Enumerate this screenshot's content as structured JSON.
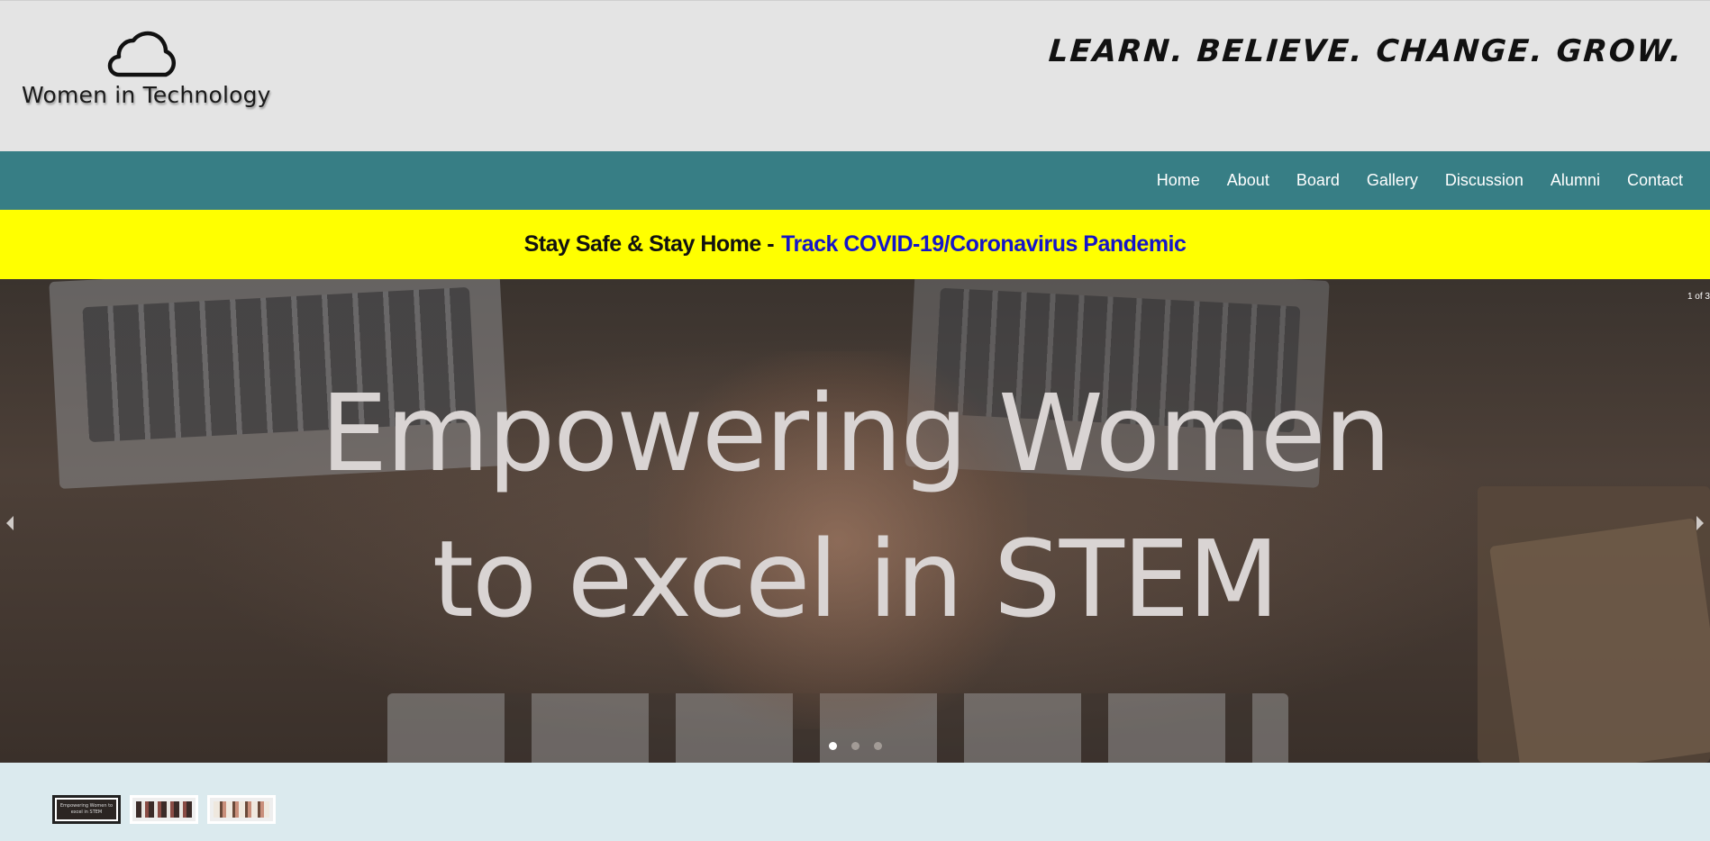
{
  "header": {
    "logo_text": "Women in Technology",
    "tagline": "LEARN. BELIEVE. CHANGE. GROW."
  },
  "nav": {
    "items": [
      {
        "label": "Home"
      },
      {
        "label": "About"
      },
      {
        "label": "Board"
      },
      {
        "label": "Gallery"
      },
      {
        "label": "Discussion"
      },
      {
        "label": "Alumni"
      },
      {
        "label": "Contact"
      }
    ]
  },
  "alert": {
    "text": "Stay Safe & Stay Home -",
    "link_text": "Track COVID-19/Coronavirus Pandemic"
  },
  "slider": {
    "headline_line1": "Empowering Women",
    "headline_line2": "to excel in STEM",
    "counter": "1 of 3",
    "current_slide": 1,
    "total_slides": 3,
    "thumb1_caption": "Empowering Women to excel in STEM"
  },
  "colors": {
    "header_bg": "#e4e4e4",
    "nav_bg": "#377e85",
    "alert_bg": "#ffff00",
    "link": "#1515c8",
    "footer_bg": "#dbeaee"
  }
}
